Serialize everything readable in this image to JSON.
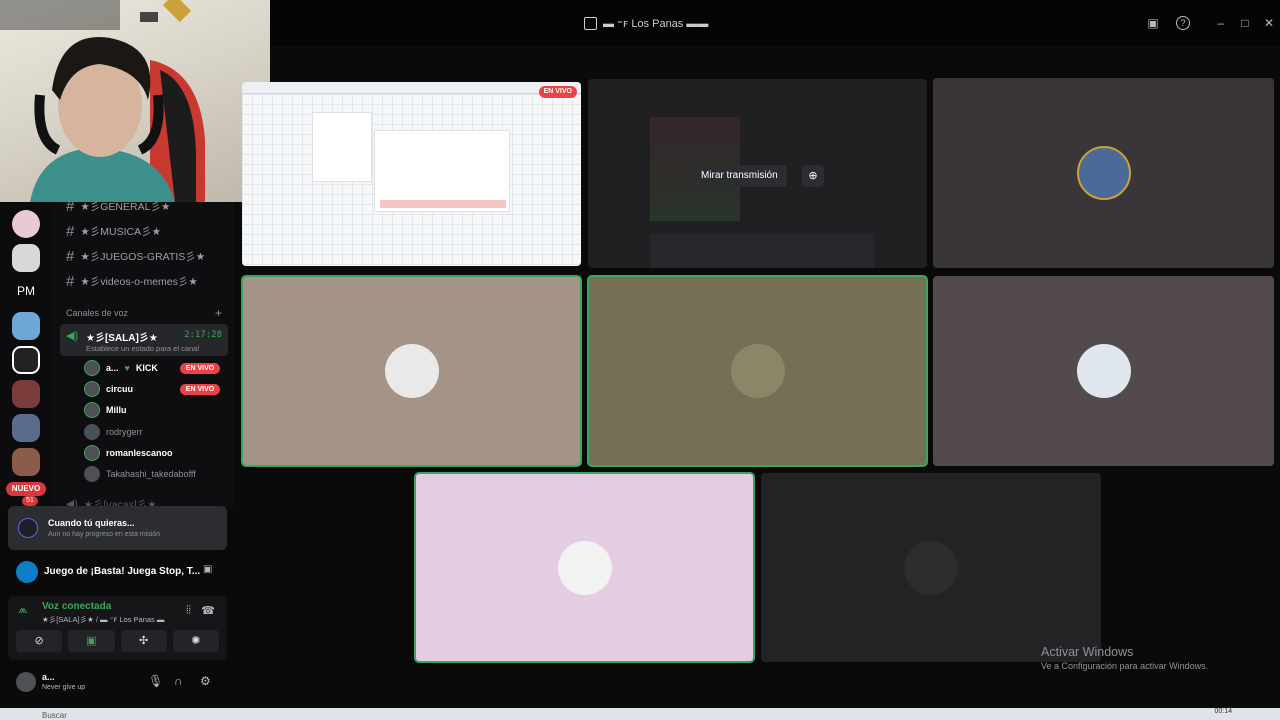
{
  "window": {
    "title": "▬ ⁼ꜰ Los Panas ▬▬"
  },
  "rail": {
    "pm_label": "PM",
    "nuevo_label": "NUEVO",
    "nuevo_count": "51"
  },
  "channels": {
    "text": [
      "★彡GENERAL彡★",
      "★彡MUSICA彡★",
      "★彡JUEGOS-GRATIS彡★",
      "★彡videos-o-memes彡★"
    ],
    "voice_category": "Canales de voz",
    "voice_channel": {
      "name": "★彡[SALA]彡★",
      "time": "2:17:28",
      "status": "Establece un estado para el canal"
    },
    "members": [
      {
        "name": "a...",
        "tag": "KICK",
        "live": "EN VIVO"
      },
      {
        "name": "circuu",
        "live": "EN VIVO"
      },
      {
        "name": "Millu"
      },
      {
        "name": "rodrygerr"
      },
      {
        "name": "romanlescanoo"
      },
      {
        "name": "Takahashi_takedabofff"
      }
    ],
    "next_channel": "★彡[vacas]彡★"
  },
  "activity": {
    "title": "Cuando tú quieras...",
    "subtitle": "Aun no hay progreso en esta misión"
  },
  "game": {
    "title": "Juego de ¡Basta! Juega Stop, T..."
  },
  "voice_connected": {
    "label": "Voz conectada",
    "channel": "★彡[SALA]彡★ / ▬ ⁼ꜰ Los Panas ▬"
  },
  "user": {
    "name": "a...",
    "status": "Never give up"
  },
  "stage": {
    "live_badge": "EN VIVO",
    "watch_label": "Mirar transmisión"
  },
  "watermark": {
    "line1": "Activar Windows",
    "line2": "Ve a Configuración para activar Windows."
  },
  "taskbar": {
    "search": "Buscar",
    "time": "00:14"
  },
  "colors": {
    "accent_green": "#3ba55d",
    "live_red": "#ed4245",
    "tile_tan": "#a49488",
    "tile_olive": "#737055",
    "tile_lilac": "#e2cde3"
  }
}
